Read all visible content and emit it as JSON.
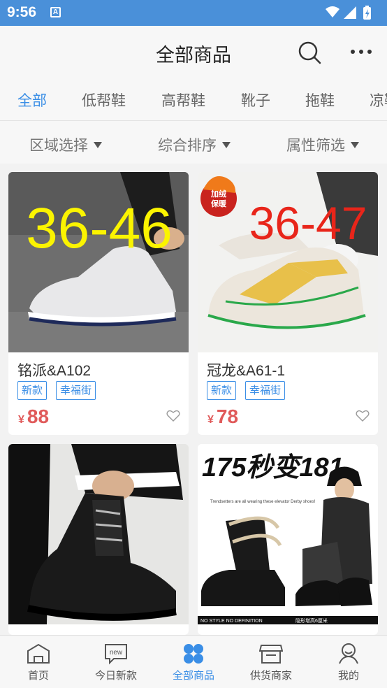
{
  "status_bar": {
    "time": "9:56",
    "notification_icon": "A"
  },
  "header": {
    "title": "全部商品",
    "search_icon": "search-icon",
    "more_icon": "more-icon"
  },
  "tabs": [
    {
      "label": "全部",
      "active": true
    },
    {
      "label": "低帮鞋"
    },
    {
      "label": "高帮鞋"
    },
    {
      "label": "靴子"
    },
    {
      "label": "拖鞋"
    },
    {
      "label": "凉鞋"
    }
  ],
  "filters": [
    {
      "label": "区域选择"
    },
    {
      "label": "综合排序"
    },
    {
      "label": "属性筛选"
    }
  ],
  "products": [
    {
      "name": "铭派&A102",
      "tags": [
        "新款",
        "幸福街"
      ],
      "currency": "¥",
      "price": "88",
      "image_text": "36-46"
    },
    {
      "name": "冠龙&A61-1",
      "tags": [
        "新款",
        "幸福街"
      ],
      "currency": "¥",
      "price": "78",
      "image_text": "36-47",
      "badge": "加绒保暖"
    },
    {
      "name": "",
      "tags": [],
      "price": ""
    },
    {
      "name": "",
      "tags": [],
      "price": "",
      "image_text": "175秒变181",
      "image_caption": "NO STYLE NO DEFINITION",
      "image_caption2": "隐形增高6厘米",
      "image_small": "Trendsetters are all wearing these elevator Derby shoes!"
    }
  ],
  "colors": {
    "accent": "#3a8ee6",
    "status_bar": "#4a90d9",
    "price": "#e05a5a"
  },
  "bottom_nav": [
    {
      "label": "首页",
      "icon": "home-icon"
    },
    {
      "label": "今日新款",
      "icon": "new-icon",
      "badge_text": "new"
    },
    {
      "label": "全部商品",
      "icon": "all-products-icon",
      "active": true
    },
    {
      "label": "供货商家",
      "icon": "store-icon"
    },
    {
      "label": "我的",
      "icon": "profile-icon"
    }
  ]
}
